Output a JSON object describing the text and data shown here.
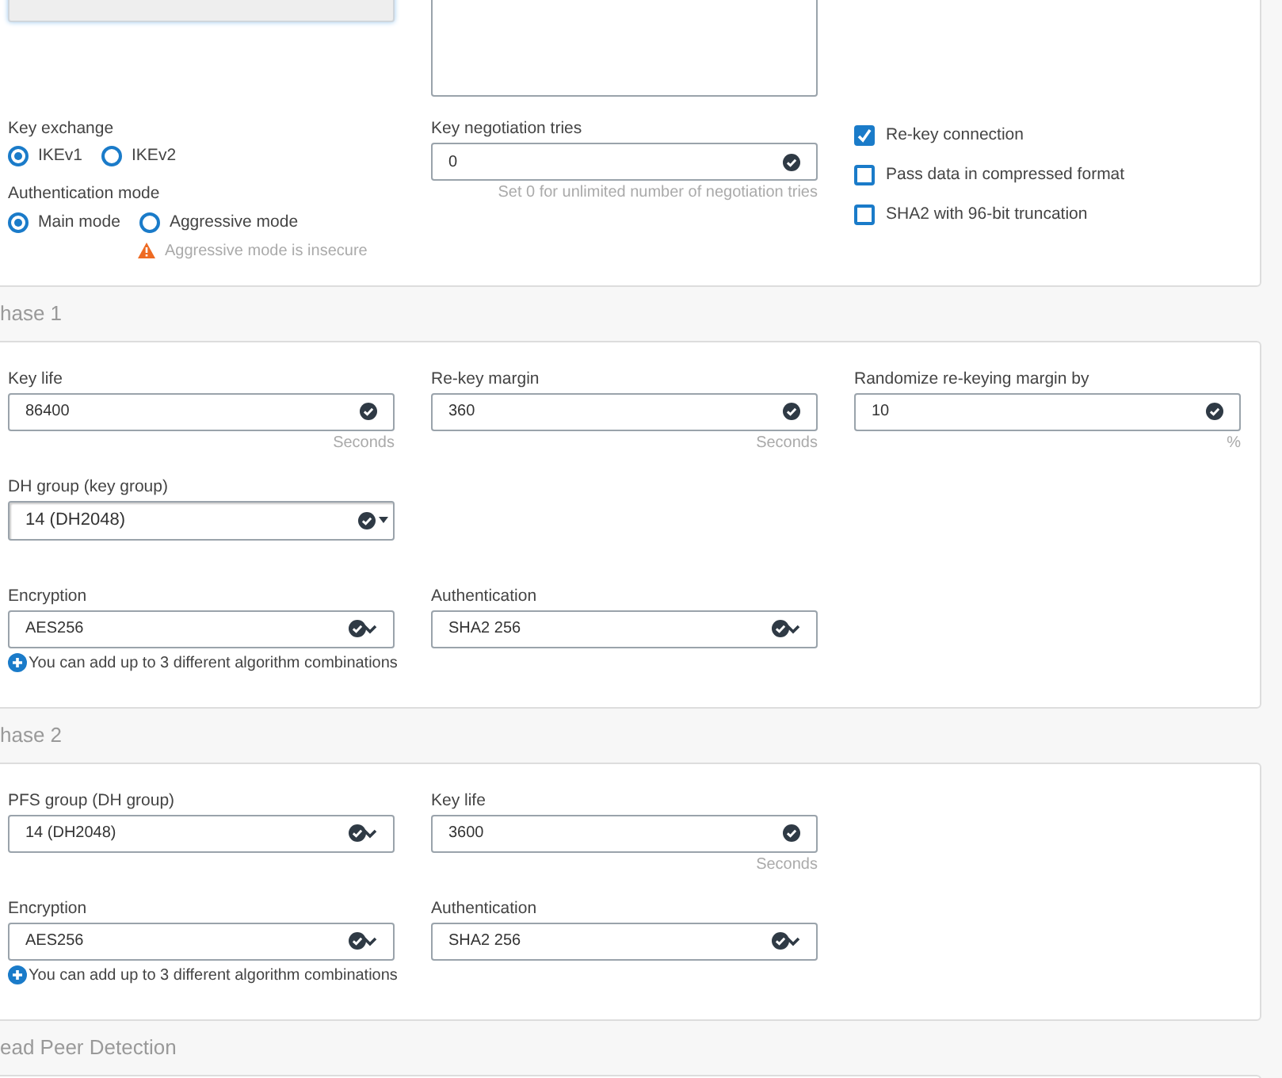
{
  "general": {
    "key_exchange": {
      "label": "Key exchange",
      "options": [
        {
          "label": "IKEv1",
          "selected": true
        },
        {
          "label": "IKEv2",
          "selected": false
        }
      ]
    },
    "authentication_mode": {
      "label": "Authentication mode",
      "options": [
        {
          "label": "Main mode",
          "selected": true
        },
        {
          "label": "Aggressive mode",
          "selected": false
        }
      ],
      "warning": "Aggressive mode is insecure"
    },
    "key_negotiation_tries": {
      "label": "Key negotiation tries",
      "value": "0",
      "hint": "Set 0 for unlimited number of negotiation tries"
    },
    "checkboxes": [
      {
        "label": "Re-key connection",
        "checked": true
      },
      {
        "label": "Pass data in compressed format",
        "checked": false
      },
      {
        "label": "SHA2 with 96-bit truncation",
        "checked": false
      }
    ]
  },
  "phase_1": {
    "title": "hase 1",
    "rows": [
      [
        {
          "kind": "input",
          "label": "Key life",
          "value": "86400",
          "unit": "Seconds"
        },
        {
          "kind": "input",
          "label": "Re-key margin",
          "value": "360",
          "unit": "Seconds"
        },
        {
          "kind": "input",
          "label": "Randomize re-keying margin by",
          "value": "10",
          "unit": "%"
        }
      ],
      [
        {
          "kind": "dropdown",
          "label": "DH group (key group)",
          "value": "14 (DH2048)"
        }
      ],
      [
        {
          "kind": "multiselect",
          "label": "Encryption",
          "value": "AES256"
        },
        {
          "kind": "multiselect",
          "label": "Authentication",
          "value": "SHA2 256"
        }
      ]
    ],
    "note": "You can add up to 3 different algorithm combinations"
  },
  "phase_2": {
    "title": "hase 2",
    "rows": [
      [
        {
          "kind": "multiselect",
          "label": "PFS group (DH group)",
          "value": "14 (DH2048)"
        },
        {
          "kind": "input",
          "label": "Key life",
          "value": "3600",
          "unit": "Seconds"
        }
      ],
      [
        {
          "kind": "multiselect",
          "label": "Encryption",
          "value": "AES256"
        },
        {
          "kind": "multiselect",
          "label": "Authentication",
          "value": "SHA2 256"
        }
      ]
    ],
    "note": "You can add up to 3 different algorithm combinations"
  },
  "dead_peer_detection": {
    "title": "ead Peer Detection"
  }
}
